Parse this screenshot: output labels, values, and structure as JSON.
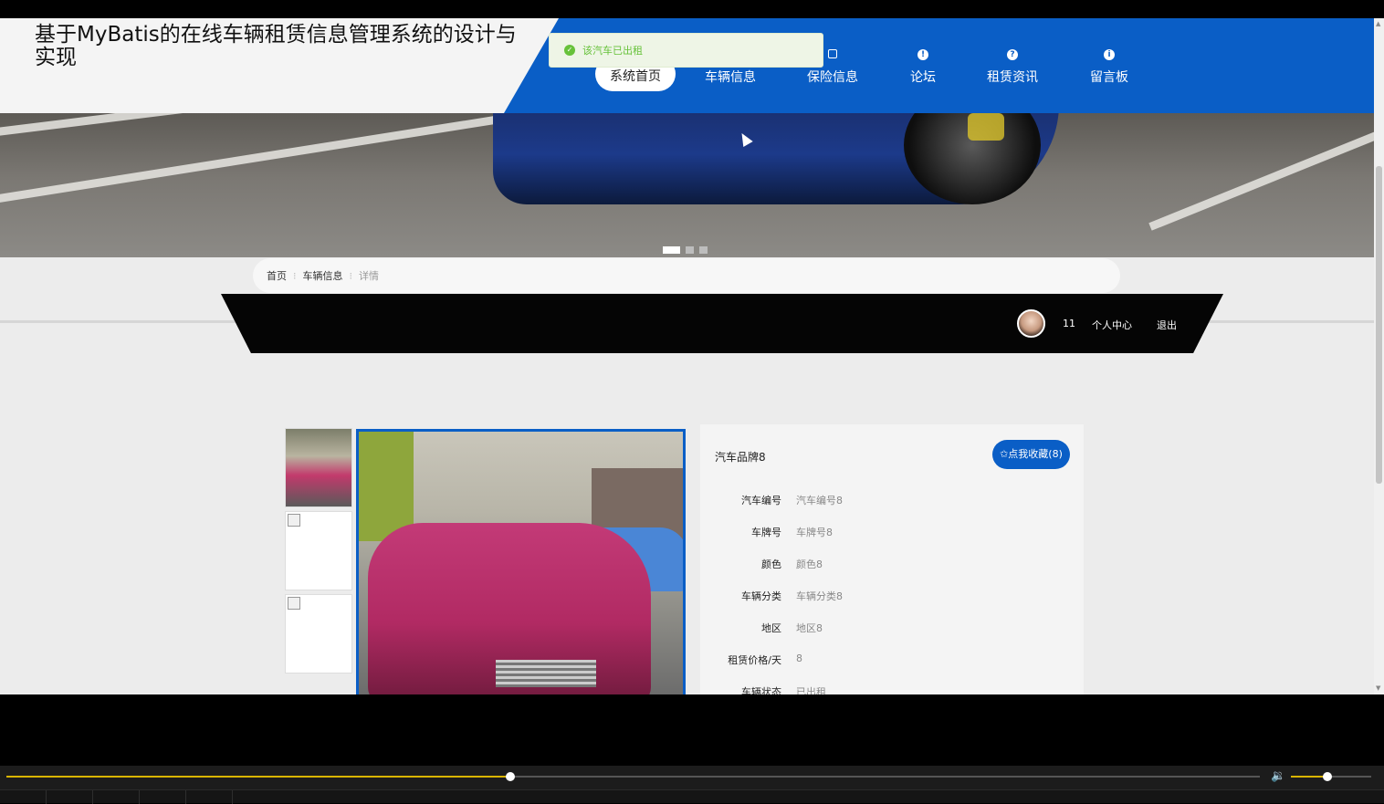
{
  "header": {
    "site_title": "基于MyBatis的在线车辆租赁信息管理系统的设计与实现",
    "nav": [
      {
        "label": "系统首页",
        "icon": "home-icon"
      },
      {
        "label": "车辆信息",
        "icon": "car-icon"
      },
      {
        "label": "保险信息",
        "icon": "bag-icon"
      },
      {
        "label": "论坛",
        "icon": "exclamation-icon"
      },
      {
        "label": "租赁资讯",
        "icon": "question-icon"
      },
      {
        "label": "留言板",
        "icon": "info-icon"
      }
    ]
  },
  "toast": {
    "message": "该汽车已出租",
    "color": "#67c23a"
  },
  "banner": {
    "slides": 3,
    "active_slide": 1
  },
  "breadcrumb": {
    "home": "首页",
    "section": "车辆信息",
    "current": "详情"
  },
  "userbar": {
    "username": "11",
    "profile_label": "个人中心",
    "logout_label": "退出"
  },
  "detail": {
    "brand": "汽车品牌8",
    "favorite_label": "✩点我收藏(8)",
    "fields": [
      {
        "key": "汽车编号",
        "value": "汽车编号8"
      },
      {
        "key": "车牌号",
        "value": "车牌号8"
      },
      {
        "key": "颜色",
        "value": "颜色8"
      },
      {
        "key": "车辆分类",
        "value": "车辆分类8"
      },
      {
        "key": "地区",
        "value": "地区8"
      },
      {
        "key": "租赁价格/天",
        "value": "8"
      },
      {
        "key": "车辆状态",
        "value": "已出租"
      }
    ]
  },
  "player": {
    "progress": 0.402,
    "volume": 0.45,
    "accent": "#d9b400"
  },
  "colors": {
    "primary": "#0a5ec6",
    "header_bg": "#f4f4f4",
    "page_bg": "#ececec"
  }
}
